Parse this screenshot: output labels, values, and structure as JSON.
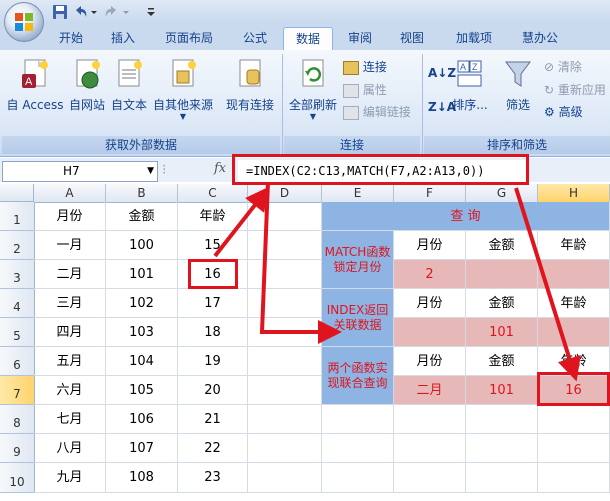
{
  "ribbon": {
    "tabs": [
      "开始",
      "插入",
      "页面布局",
      "公式",
      "数据",
      "审阅",
      "视图",
      "加载项",
      "慧办公"
    ],
    "active_tab": "数据",
    "groups": {
      "external": {
        "label": "获取外部数据",
        "buttons": [
          "自 Access",
          "自网站",
          "自文本",
          "自其他来源",
          "现有连接"
        ]
      },
      "connections": {
        "label": "连接",
        "refresh": "全部刷新",
        "items": [
          "连接",
          "属性",
          "编辑链接"
        ]
      },
      "sort_filter": {
        "label": "排序和筛选",
        "sort": "排序...",
        "filter": "筛选",
        "items": [
          "清除",
          "重新应用",
          "高级"
        ]
      }
    }
  },
  "formula_bar": {
    "namebox": "H7",
    "fx": "fx",
    "formula": "=INDEX(C2:C13,MATCH(F7,A2:A13,0))"
  },
  "columns": [
    "A",
    "B",
    "C",
    "D",
    "E",
    "F",
    "G",
    "H"
  ],
  "rows": [
    "1",
    "2",
    "3",
    "4",
    "5",
    "6",
    "7",
    "8",
    "9",
    "10"
  ],
  "table": {
    "headers": [
      "月份",
      "金额",
      "年龄"
    ],
    "rows": [
      [
        "一月",
        "100",
        "15"
      ],
      [
        "二月",
        "101",
        "16"
      ],
      [
        "三月",
        "102",
        "17"
      ],
      [
        "四月",
        "103",
        "18"
      ],
      [
        "五月",
        "104",
        "19"
      ],
      [
        "六月",
        "105",
        "20"
      ],
      [
        "七月",
        "106",
        "21"
      ],
      [
        "八月",
        "107",
        "22"
      ],
      [
        "九月",
        "108",
        "23"
      ]
    ]
  },
  "lookup": {
    "title": "查 询",
    "headers": [
      "月份",
      "金额",
      "年龄"
    ],
    "sec1": {
      "label": "MATCH函数锁定月份",
      "result": "2"
    },
    "sec2": {
      "label": "INDEX返回关联数据",
      "result": "101"
    },
    "sec3": {
      "label": "两个函数实现联合查询",
      "month": "二月",
      "amount": "101",
      "age": "16"
    }
  },
  "colors": {
    "accent_red": "#e0141e",
    "lookup_blue": "#8db4e2",
    "lookup_pink": "#e6b8b7"
  }
}
